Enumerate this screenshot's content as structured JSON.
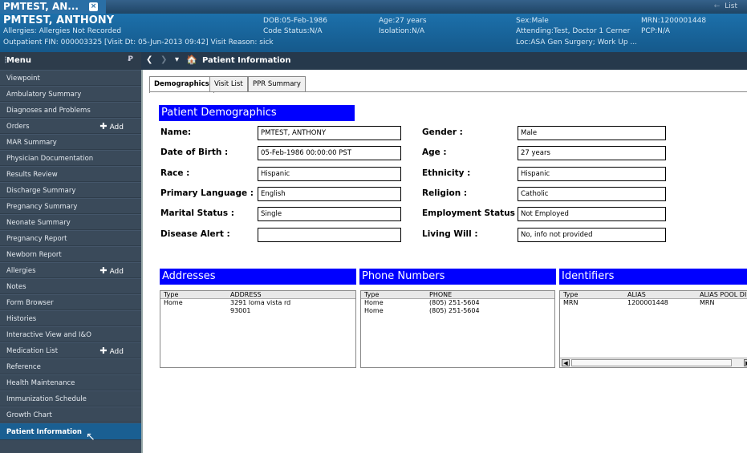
{
  "tabbar": {
    "patient_tab": "PMTEST, AN...",
    "close": "×",
    "list": "List",
    "list_arrow": "←"
  },
  "banner": {
    "name": "PMTEST, ANTHONY",
    "allergies": "Allergies: Allergies Not Recorded",
    "encounter": "Outpatient FIN: 000003325 [Visit Dt: 05-Jun-2013 09:42] Visit Reason: sick",
    "dob": "DOB:05-Feb-1986",
    "code_status": "Code Status:N/A",
    "age": "Age:27 years",
    "isolation": "Isolation:N/A",
    "sex": "Sex:Male",
    "attending": "Attending:Test, Doctor 1 Cerner",
    "loc": "Loc:ASA Gen Surgery; Work Up ...",
    "mrn": "MRN:1200001448",
    "pcp": "PCP:N/A"
  },
  "menu": {
    "title": "Menu",
    "pin": "Ꝑ",
    "dots": "⋮",
    "add_label": "Add",
    "add_icon": "✚",
    "items": [
      {
        "label": "Viewpoint",
        "add": false
      },
      {
        "label": "Ambulatory Summary",
        "add": false
      },
      {
        "label": "Diagnoses and Problems",
        "add": false
      },
      {
        "label": "Orders",
        "add": true
      },
      {
        "label": "MAR Summary",
        "add": false
      },
      {
        "label": "Physician Documentation",
        "add": false
      },
      {
        "label": "Results Review",
        "add": false
      },
      {
        "label": "Discharge Summary",
        "add": false
      },
      {
        "label": "Pregnancy Summary",
        "add": false
      },
      {
        "label": "Neonate Summary",
        "add": false
      },
      {
        "label": "Pregnancy Report",
        "add": false
      },
      {
        "label": "Newborn Report",
        "add": false
      },
      {
        "label": "Allergies",
        "add": true
      },
      {
        "label": "Notes",
        "add": false
      },
      {
        "label": "Form Browser",
        "add": false
      },
      {
        "label": "Histories",
        "add": false
      },
      {
        "label": "Interactive View and I&O",
        "add": false
      },
      {
        "label": "Medication List",
        "add": true
      },
      {
        "label": "Reference",
        "add": false
      },
      {
        "label": "Health Maintenance",
        "add": false
      },
      {
        "label": "Immunization Schedule",
        "add": false
      },
      {
        "label": "Growth Chart",
        "add": false
      },
      {
        "label": "Patient Information",
        "add": false,
        "selected": true
      }
    ]
  },
  "nav": {
    "back": "❮",
    "fwd": "❯",
    "dropdown": "▾",
    "home": "🏠",
    "title": "Patient Information"
  },
  "tabs": [
    "Demographics",
    "Visit List",
    "PPR Summary"
  ],
  "demographics": {
    "heading": "Patient Demographics",
    "fields": [
      {
        "label": "Name:",
        "value": "PMTEST, ANTHONY"
      },
      {
        "label": "Gender :",
        "value": "Male"
      },
      {
        "label": "Date of Birth :",
        "value": "05-Feb-1986 00:00:00 PST"
      },
      {
        "label": "Age :",
        "value": "27 years"
      },
      {
        "label": "Race :",
        "value": "Hispanic"
      },
      {
        "label": "Ethnicity :",
        "value": "Hispanic"
      },
      {
        "label": "Primary Language :",
        "value": "English"
      },
      {
        "label": "Religion :",
        "value": "Catholic"
      },
      {
        "label": "Marital Status :",
        "value": "Single"
      },
      {
        "label": "Employment Status :",
        "value": "Not Employed"
      },
      {
        "label": "Disease Alert :",
        "value": ""
      },
      {
        "label": "Living Will :",
        "value": "No, info not provided"
      }
    ]
  },
  "addresses": {
    "heading": "Addresses",
    "cols": [
      "Type",
      "ADDRESS"
    ],
    "rows": [
      [
        "Home",
        "3291 loma vista rd"
      ],
      [
        "",
        "93001"
      ]
    ]
  },
  "phones": {
    "heading": "Phone Numbers",
    "cols": [
      "Type",
      "PHONE"
    ],
    "rows": [
      [
        "Home",
        "(805) 251-5604"
      ],
      [
        "Home",
        "(805) 251-5604"
      ]
    ]
  },
  "identifiers": {
    "heading": "Identifiers",
    "cols": [
      "Type",
      "ALIAS",
      "ALIAS POOL DIS"
    ],
    "rows": [
      [
        "MRN",
        "1200001448",
        "MRN"
      ]
    ],
    "scroll_left": "◀",
    "scroll_right": "▶"
  }
}
